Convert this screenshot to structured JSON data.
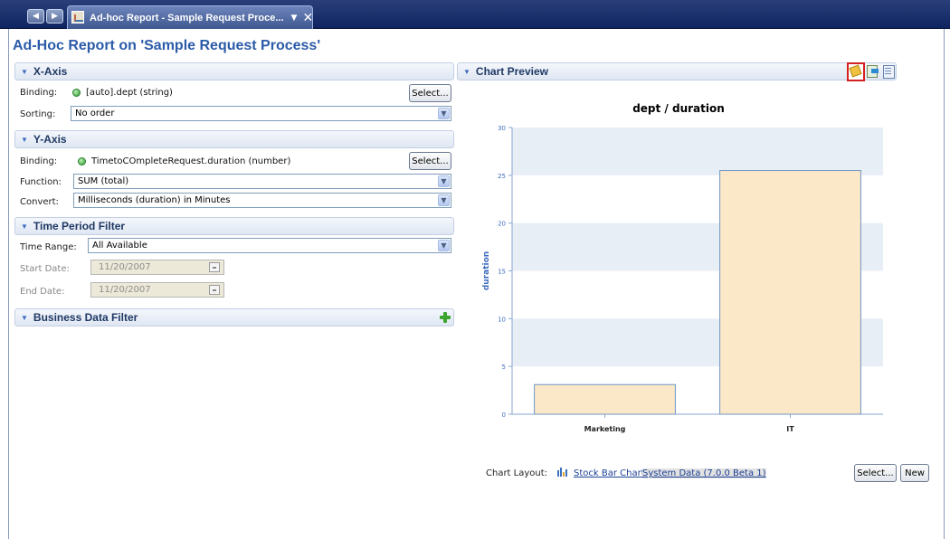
{
  "window": {
    "tab_title": "Ad-hoc Report - Sample Request Proce...",
    "tab_menu_icon": "dropdown-icon",
    "close_icon": "close-icon",
    "nav_back_icon": "arrow-left-icon",
    "nav_forward_icon": "arrow-right-icon"
  },
  "page": {
    "title": "Ad-Hoc Report on 'Sample Request Process'"
  },
  "x_axis": {
    "header": "X-Axis",
    "binding_label": "Binding:",
    "binding_value": "[auto].dept (string)",
    "select_label": "Select...",
    "sorting_label": "Sorting:",
    "sorting_value": "No order"
  },
  "y_axis": {
    "header": "Y-Axis",
    "binding_label": "Binding:",
    "binding_value": "TimetoCOmpleteRequest.duration (number)",
    "select_label": "Select...",
    "function_label": "Function:",
    "function_value": "SUM (total)",
    "convert_label": "Convert:",
    "convert_value": "Milliseconds (duration) in Minutes"
  },
  "time_filter": {
    "header": "Time Period Filter",
    "range_label": "Time Range:",
    "range_value": "All Available",
    "start_label": "Start Date:",
    "start_value": "11/20/2007",
    "end_label": "End Date:",
    "end_value": "11/20/2007"
  },
  "business_filter": {
    "header": "Business Data Filter"
  },
  "chart_preview": {
    "header": "Chart Preview",
    "layout_label": "Chart Layout:",
    "layout_link": "Stock Bar Chart",
    "data_link": "System Data (7.0.0 Beta 1)",
    "select_label": "Select...",
    "new_label": "New"
  },
  "chart_data": {
    "type": "bar",
    "title": "dept / duration",
    "xlabel": "",
    "ylabel": "duration",
    "categories": [
      "Marketing",
      "IT"
    ],
    "values": [
      3.1,
      25.5
    ],
    "ylim": [
      0,
      30
    ],
    "yticks": [
      0,
      5,
      10,
      15,
      20,
      25,
      30
    ],
    "bar_color": "#fbe8c8",
    "bar_border": "#6f98c4",
    "band_color": "#e8eef6",
    "grid": false
  }
}
